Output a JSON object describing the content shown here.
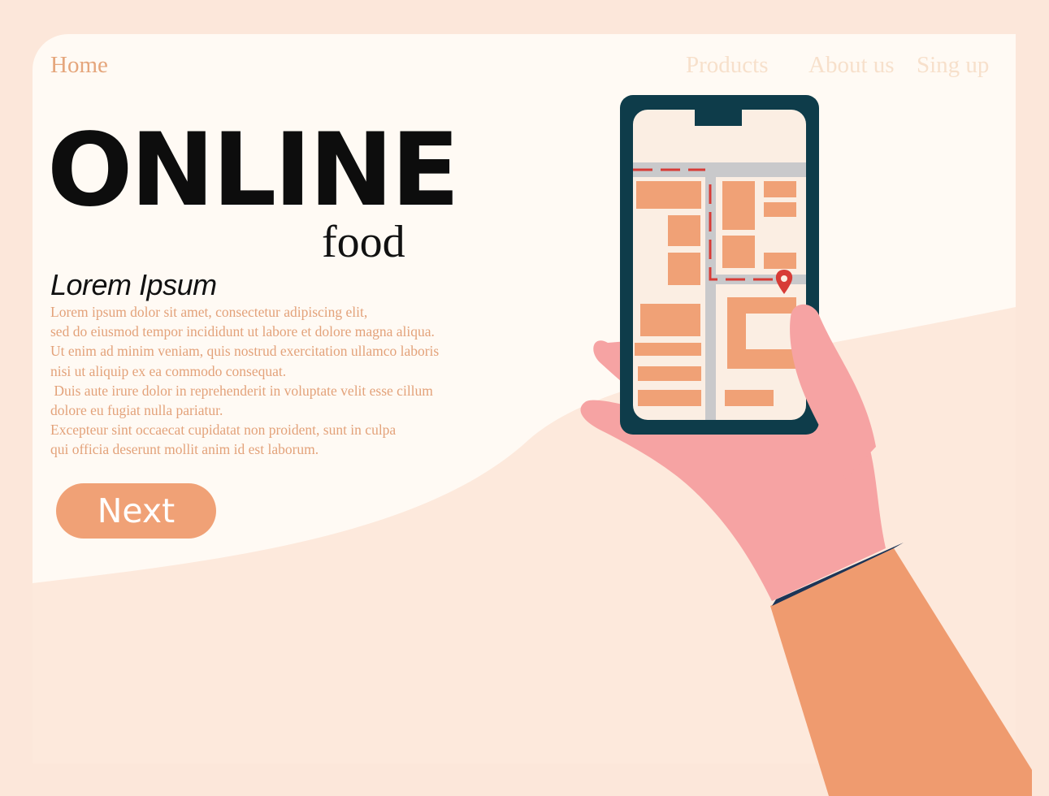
{
  "nav": {
    "home": "Home",
    "products": "Products",
    "about": "About us",
    "signup": "Sing up"
  },
  "hero": {
    "title": "ONLINE",
    "subtitle": "food",
    "heading": "Lorem Ipsum",
    "body_lines": [
      "Lorem ipsum dolor sit amet, consectetur adipiscing elit,",
      "sed do eiusmod tempor incididunt ut labore et dolore magna aliqua.",
      "Ut enim ad minim veniam, quis nostrud exercitation ullamco laboris",
      "nisi ut aliquip ex ea commodo consequat.",
      " Duis aute irure dolor in reprehenderit in voluptate velit esse cillum",
      "dolore eu fugiat nulla pariatur.",
      "Excepteur sint occaecat cupidatat non proident, sunt in culpa",
      "qui officia deserunt mollit anim id est laborum."
    ],
    "next_label": "Next"
  },
  "icons": {
    "map_pin": "location-pin-icon"
  },
  "colors": {
    "background": "#fce7da",
    "card": "#fffaf4",
    "accent": "#f0a176",
    "phone_frame": "#0e3c4a",
    "hand": "#f6a3a3",
    "sleeve": "#ef9b6f",
    "map_block": "#f0a176",
    "map_road": "#c9c9cb",
    "route": "#d73b36"
  }
}
